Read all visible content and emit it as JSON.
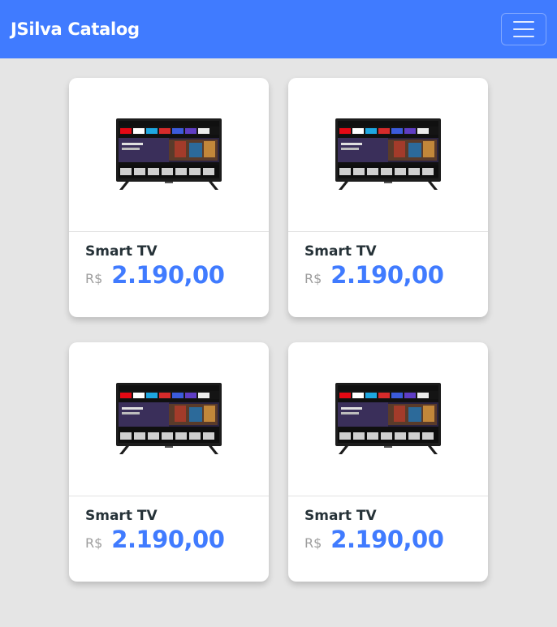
{
  "navbar": {
    "brand": "JSilva Catalog",
    "menu_icon": "hamburger-menu-icon"
  },
  "colors": {
    "primary": "#407bff",
    "background": "#e5e5e5",
    "title_text": "#263238",
    "currency_text": "#9e9e9e"
  },
  "products": [
    {
      "name": "Smart TV",
      "currency": "R$",
      "price": "2.190,00",
      "image_icon": "smart-tv-image"
    },
    {
      "name": "Smart TV",
      "currency": "R$",
      "price": "2.190,00",
      "image_icon": "smart-tv-image"
    },
    {
      "name": "Smart TV",
      "currency": "R$",
      "price": "2.190,00",
      "image_icon": "smart-tv-image"
    },
    {
      "name": "Smart TV",
      "currency": "R$",
      "price": "2.190,00",
      "image_icon": "smart-tv-image"
    }
  ]
}
